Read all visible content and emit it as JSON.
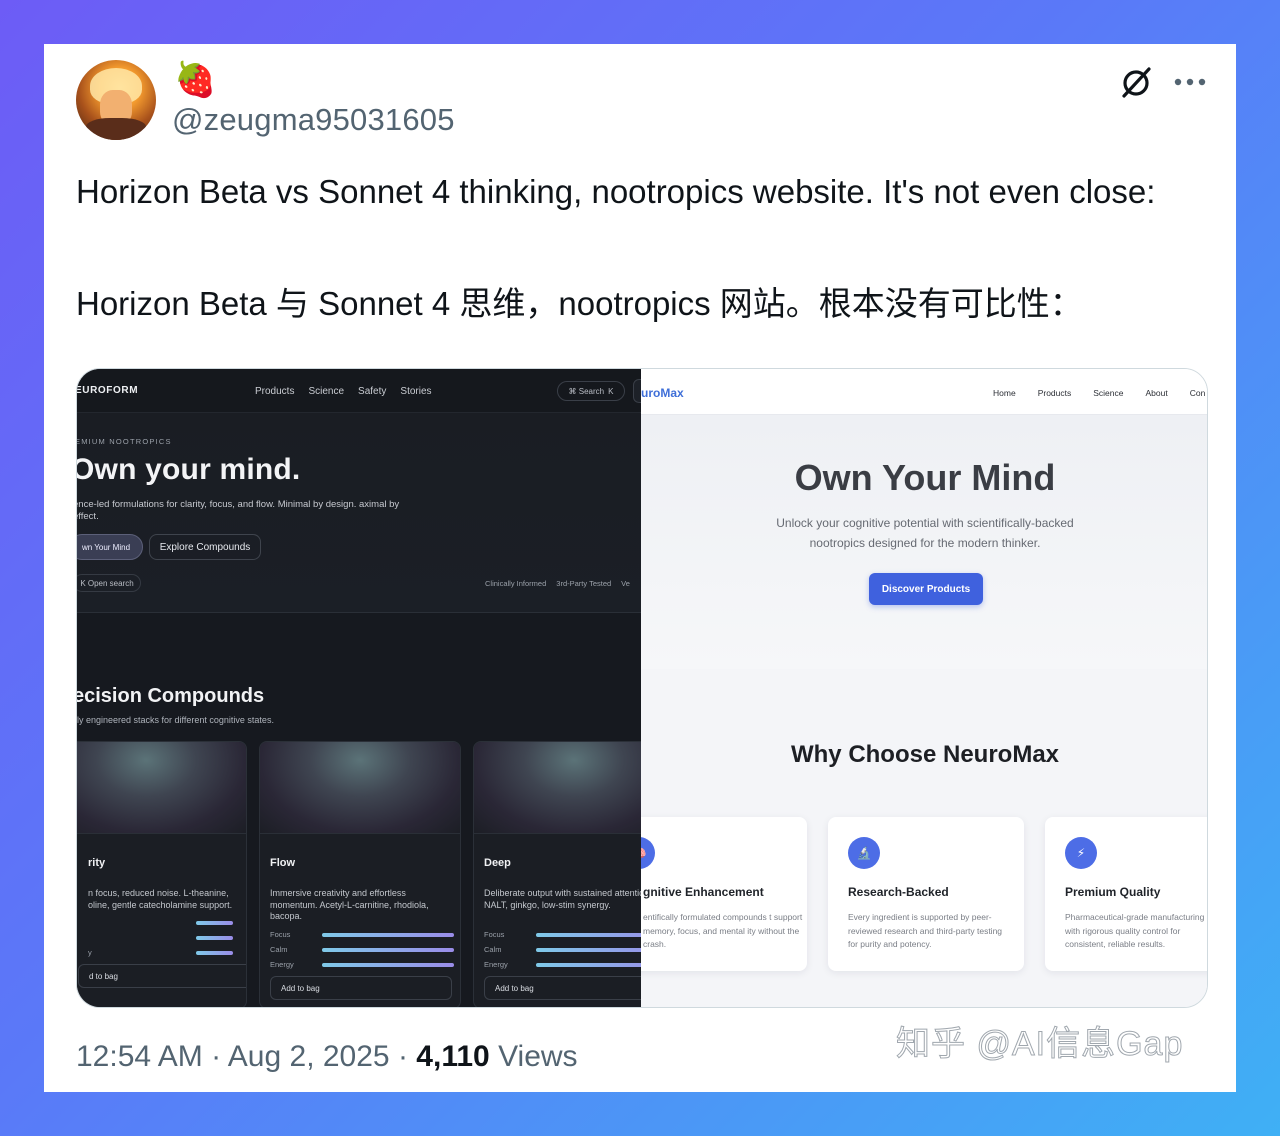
{
  "tweet": {
    "name_emoji": "🍓",
    "handle": "@zeugma95031605",
    "text_en": "Horizon Beta vs Sonnet 4 thinking, nootropics website. It's not even close:",
    "text_zh": "Horizon Beta 与 Sonnet 4 思维，nootropics 网站。根本没有可比性：",
    "time": "12:54 AM",
    "date": "Aug 2, 2025",
    "views_count": "4,110",
    "views_label": "Views",
    "sep": "·"
  },
  "icons": {
    "grok": "grok-icon",
    "more": "more-icon"
  },
  "left_site": {
    "brand": "EUROFORM",
    "nav": [
      "Products",
      "Science",
      "Safety",
      "Stories"
    ],
    "search_label": "⌘ Search",
    "search_key": "K",
    "eyebrow": "EMIUM NOOTROPICS",
    "headline": "Own your mind.",
    "subtitle": "ence-led formulations for clarity, focus, and flow. Minimal by design. aximal by effect.",
    "btn_primary": "wn Your Mind",
    "btn_secondary": "Explore Compounds",
    "open_search": "K  Open search",
    "badges": [
      "Clinically Informed",
      "3rd-Party Tested",
      "Ve"
    ],
    "section_title": "ecision Compounds",
    "section_sub": "lly engineered stacks for different cognitive states.",
    "cards": [
      {
        "title": "rity",
        "desc": "n focus, reduced noise. L-theanine, oline, gentle catecholamine support.",
        "meters": [
          {
            "label": "",
            "level": 0.85
          },
          {
            "label": "",
            "level": 0.85
          },
          {
            "label": "y",
            "level": 0.85
          }
        ],
        "bag": "d to bag"
      },
      {
        "title": "Flow",
        "desc": "Immersive creativity and effortless momentum. Acetyl-L-carnitine, rhodiola, bacopa.",
        "meters": [
          {
            "label": "Focus",
            "level": 1
          },
          {
            "label": "Calm",
            "level": 1
          },
          {
            "label": "Energy",
            "level": 1
          }
        ],
        "bag": "Add to bag"
      },
      {
        "title": "Deep",
        "desc": "Deliberate output with sustained attention. NALT, ginkgo, low-stim synergy.",
        "meters": [
          {
            "label": "Focus",
            "level": 1
          },
          {
            "label": "Calm",
            "level": 1
          },
          {
            "label": "Energy",
            "level": 1
          }
        ],
        "bag": "Add to bag"
      }
    ]
  },
  "right_site": {
    "brand": "uroMax",
    "nav": [
      "Home",
      "Products",
      "Science",
      "About",
      "Con"
    ],
    "headline": "Own Your Mind",
    "subtitle": "Unlock your cognitive potential with scientifically-backed nootropics designed for the modern thinker.",
    "cta": "Discover Products",
    "why_title": "Why Choose NeuroMax",
    "cards": [
      {
        "icon": "brain-icon",
        "glyph": "🧠",
        "title": "gnitive Enhancement",
        "desc": "entifically formulated compounds t support memory, focus, and mental ity without the crash."
      },
      {
        "icon": "microscope-icon",
        "glyph": "🔬",
        "title": "Research-Backed",
        "desc": "Every ingredient is supported by peer-reviewed research and third-party testing for purity and potency."
      },
      {
        "icon": "lightning-icon",
        "glyph": "⚡",
        "title": "Premium Quality",
        "desc": "Pharmaceutical-grade manufacturing with rigorous quality control for consistent, reliable results."
      }
    ]
  },
  "watermark": "知乎 @AI信息Gap"
}
